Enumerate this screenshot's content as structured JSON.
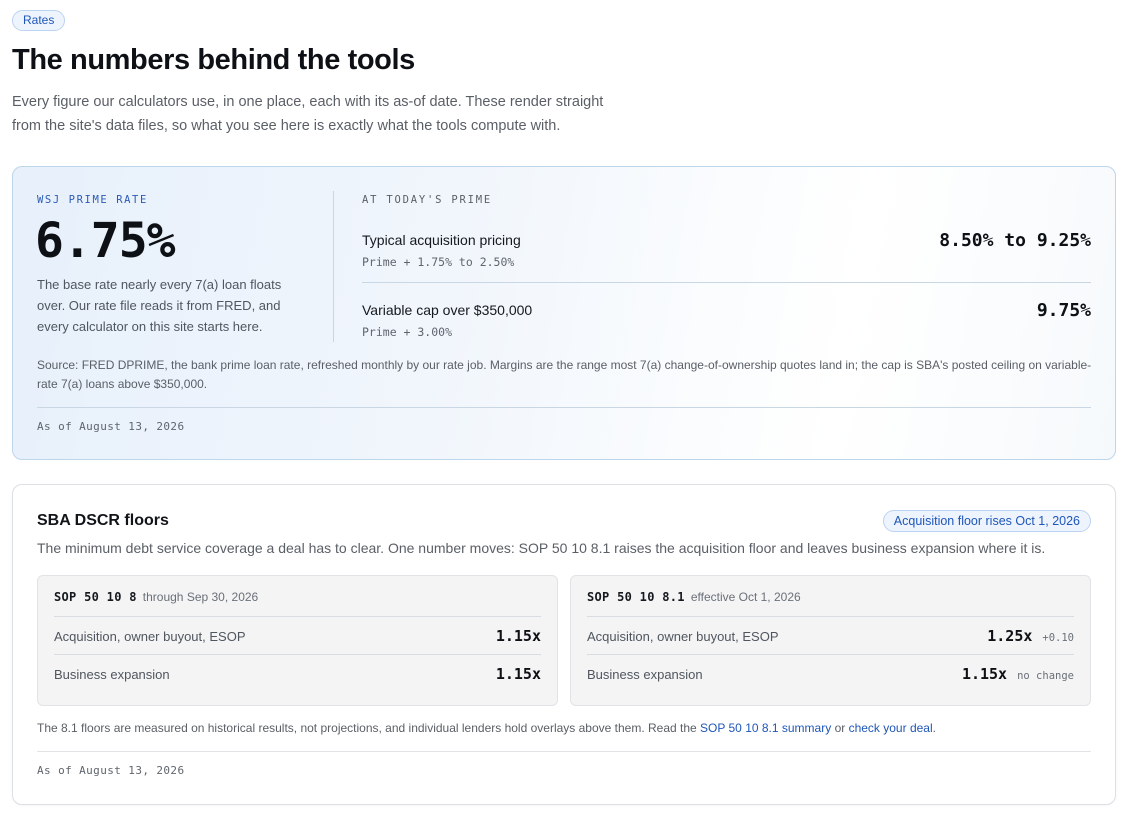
{
  "header": {
    "pill": "Rates",
    "title": "The numbers behind the tools",
    "intro_line1": "Every figure our calculators use, in one place, each with its as-of date. These render straight",
    "intro_line2": "from the site's data files, so what you see here is exactly what the tools compute with."
  },
  "prime": {
    "label": "WSJ PRIME RATE",
    "value": "6.75%",
    "description": "The base rate nearly every 7(a) loan floats over. Our rate file reads it from FRED, and every calculator on this site starts here.",
    "today_label": "AT TODAY'S PRIME",
    "rows": [
      {
        "name": "Typical acquisition pricing",
        "sub": "Prime + 1.75% to 2.50%",
        "value": "8.50% to 9.25%"
      },
      {
        "name": "Variable cap over $350,000",
        "sub": "Prime + 3.00%",
        "value": "9.75%"
      }
    ],
    "source": "Source: FRED DPRIME, the bank prime loan rate, refreshed monthly by our rate job. Margins are the range most 7(a) change-of-ownership quotes land in; the cap is SBA's posted ceiling on variable-rate 7(a) loans above $350,000.",
    "as_of": "As of August 13, 2026"
  },
  "dscr": {
    "title": "SBA DSCR floors",
    "badge": "Acquisition floor rises Oct 1, 2026",
    "description": "The minimum debt service coverage a deal has to clear. One number moves: SOP 50 10 8.1 raises the acquisition floor and leaves business expansion where it is.",
    "sops": [
      {
        "code": "SOP 50 10 8",
        "when": "through Sep 30, 2026",
        "rows": [
          {
            "label": "Acquisition, owner buyout, ESOP",
            "value": "1.15x",
            "delta": ""
          },
          {
            "label": "Business expansion",
            "value": "1.15x",
            "delta": ""
          }
        ]
      },
      {
        "code": "SOP 50 10 8.1",
        "when": "effective Oct 1, 2026",
        "rows": [
          {
            "label": "Acquisition, owner buyout, ESOP",
            "value": "1.25x",
            "delta": "+0.10"
          },
          {
            "label": "Business expansion",
            "value": "1.15x",
            "delta": "no change"
          }
        ]
      }
    ],
    "note_text1": "The 8.1 floors are measured on historical results, not projections, and individual lenders hold overlays above them. Read the ",
    "note_link1": "SOP 50 10 8.1 summary",
    "note_text2": " or ",
    "note_link2": "check your deal",
    "note_text3": ".",
    "as_of": "As of August 13, 2026"
  }
}
